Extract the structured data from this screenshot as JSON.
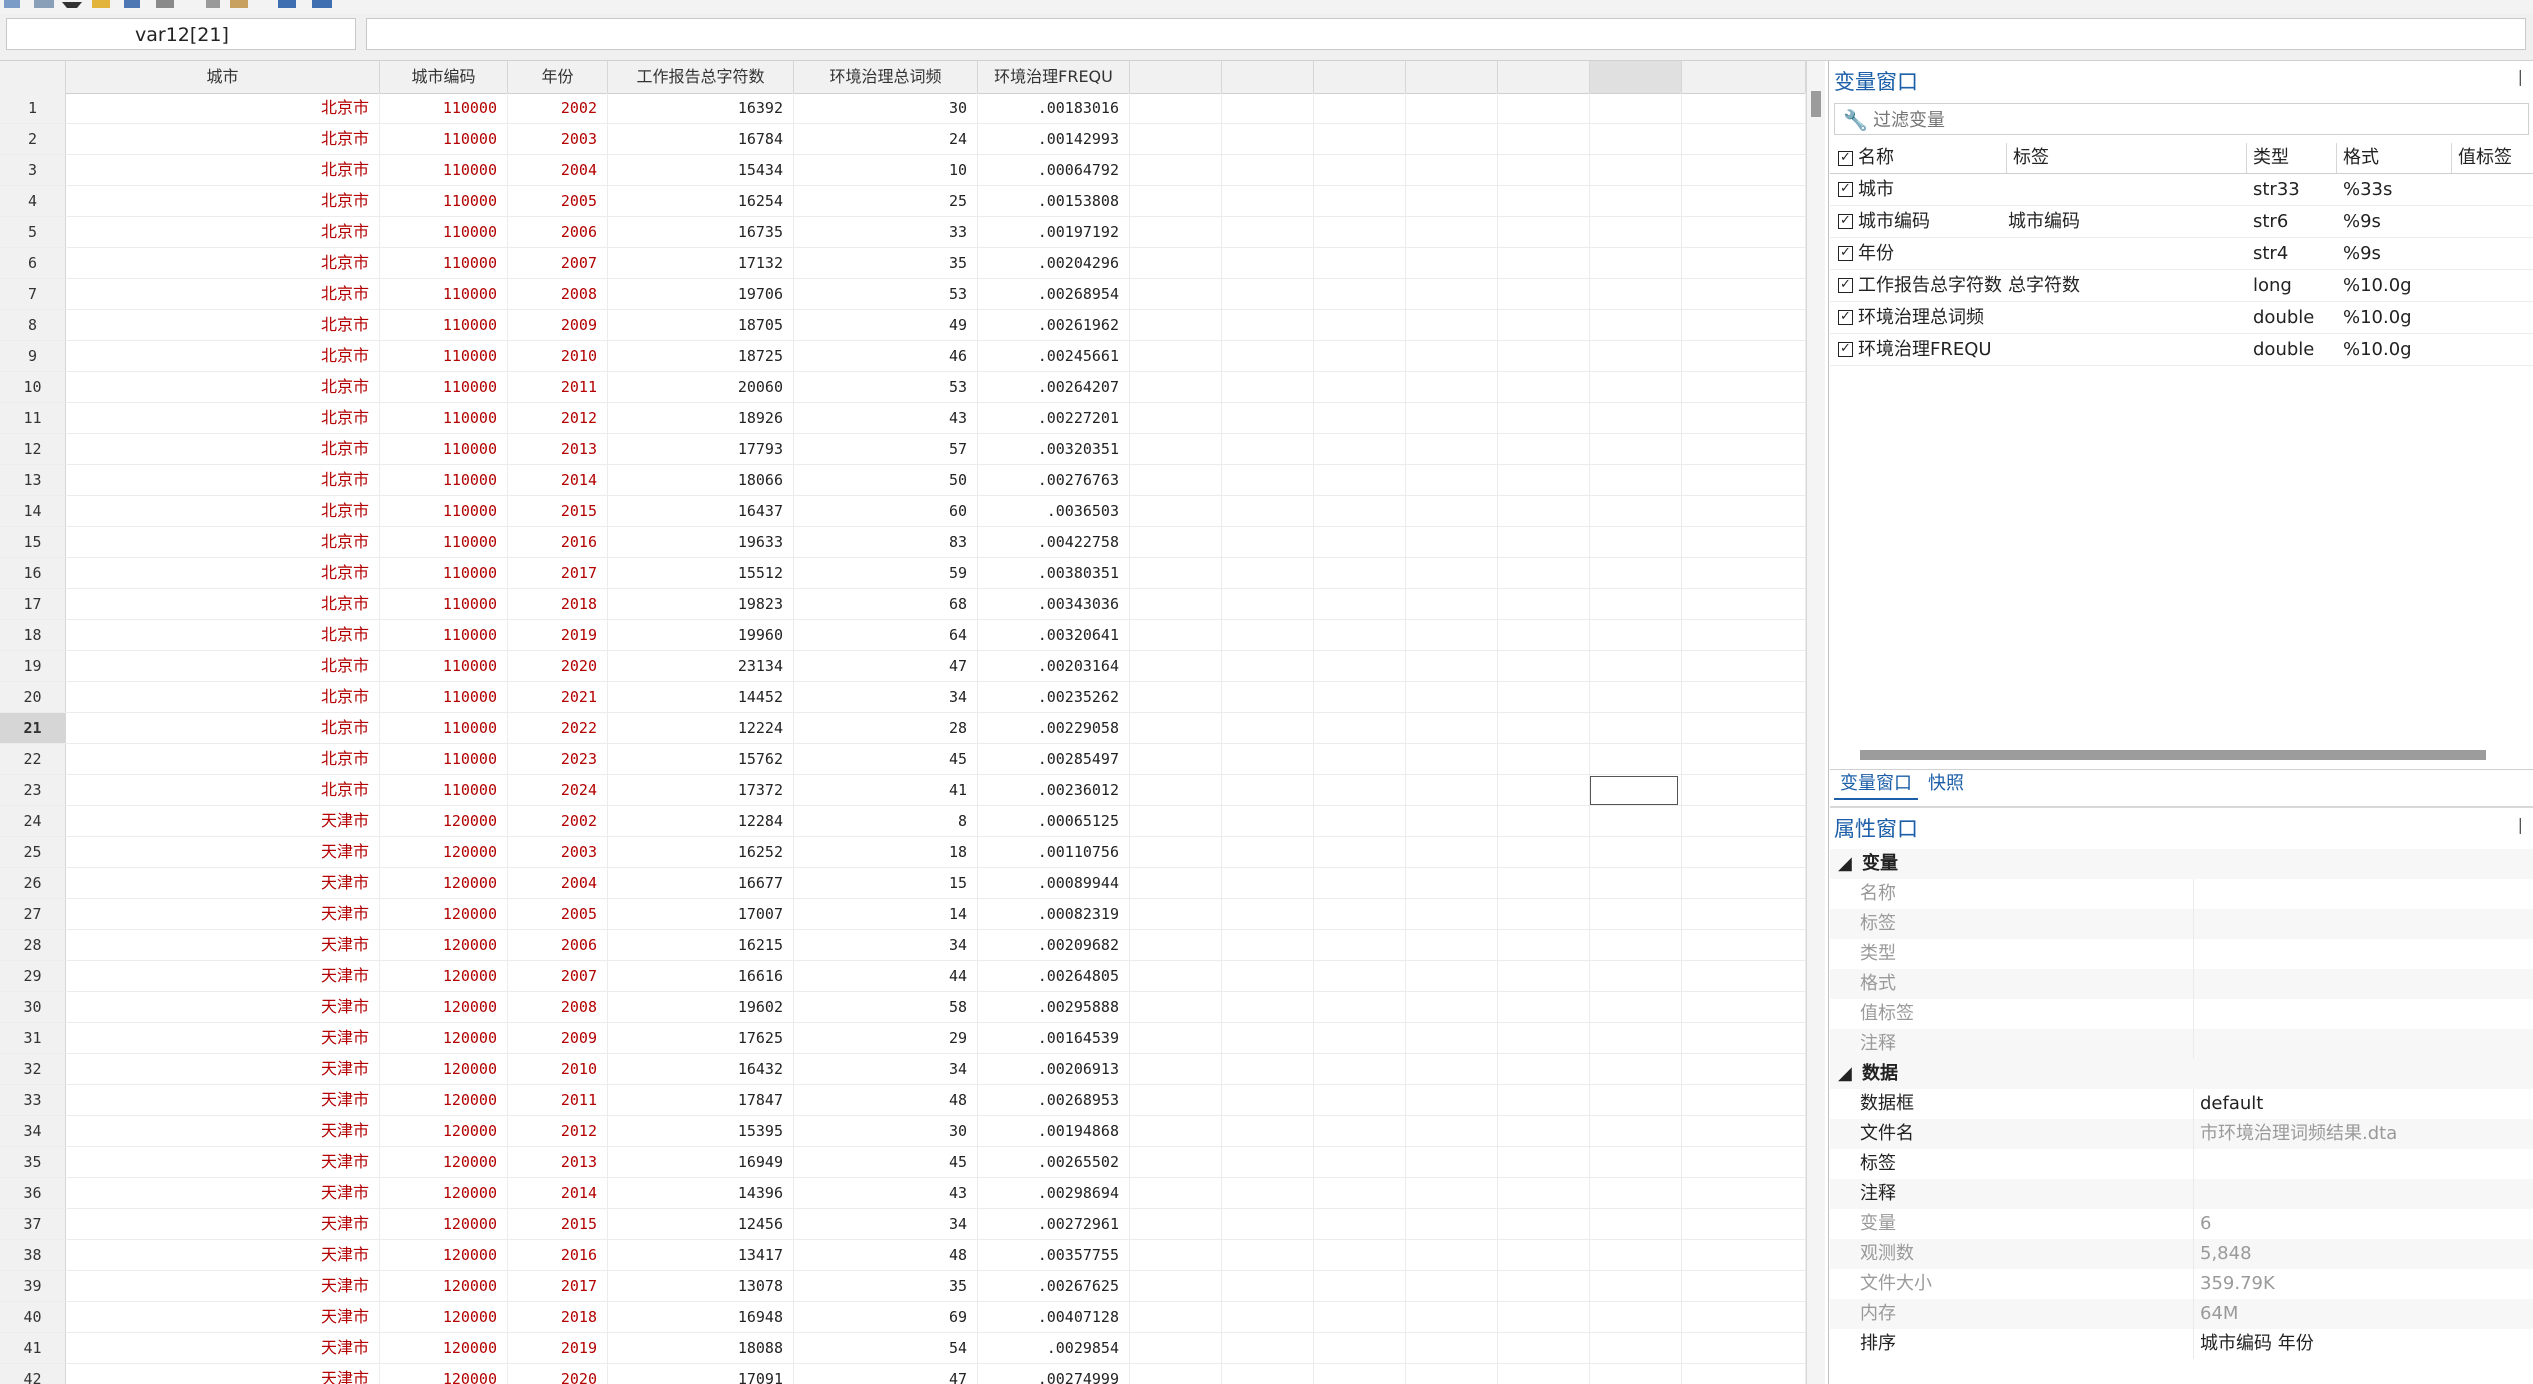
{
  "cellbar": {
    "name": "var12[21]",
    "value": ""
  },
  "grid": {
    "columns": [
      "城市",
      "城市编码",
      "年份",
      "工作报告总字符数",
      "环境治理总词频",
      "环境治理FREQU"
    ],
    "rows": [
      [
        "1",
        "北京市",
        "110000",
        "2002",
        "16392",
        "30",
        ".00183016"
      ],
      [
        "2",
        "北京市",
        "110000",
        "2003",
        "16784",
        "24",
        ".00142993"
      ],
      [
        "3",
        "北京市",
        "110000",
        "2004",
        "15434",
        "10",
        ".00064792"
      ],
      [
        "4",
        "北京市",
        "110000",
        "2005",
        "16254",
        "25",
        ".00153808"
      ],
      [
        "5",
        "北京市",
        "110000",
        "2006",
        "16735",
        "33",
        ".00197192"
      ],
      [
        "6",
        "北京市",
        "110000",
        "2007",
        "17132",
        "35",
        ".00204296"
      ],
      [
        "7",
        "北京市",
        "110000",
        "2008",
        "19706",
        "53",
        ".00268954"
      ],
      [
        "8",
        "北京市",
        "110000",
        "2009",
        "18705",
        "49",
        ".00261962"
      ],
      [
        "9",
        "北京市",
        "110000",
        "2010",
        "18725",
        "46",
        ".00245661"
      ],
      [
        "10",
        "北京市",
        "110000",
        "2011",
        "20060",
        "53",
        ".00264207"
      ],
      [
        "11",
        "北京市",
        "110000",
        "2012",
        "18926",
        "43",
        ".00227201"
      ],
      [
        "12",
        "北京市",
        "110000",
        "2013",
        "17793",
        "57",
        ".00320351"
      ],
      [
        "13",
        "北京市",
        "110000",
        "2014",
        "18066",
        "50",
        ".00276763"
      ],
      [
        "14",
        "北京市",
        "110000",
        "2015",
        "16437",
        "60",
        ".0036503"
      ],
      [
        "15",
        "北京市",
        "110000",
        "2016",
        "19633",
        "83",
        ".00422758"
      ],
      [
        "16",
        "北京市",
        "110000",
        "2017",
        "15512",
        "59",
        ".00380351"
      ],
      [
        "17",
        "北京市",
        "110000",
        "2018",
        "19823",
        "68",
        ".00343036"
      ],
      [
        "18",
        "北京市",
        "110000",
        "2019",
        "19960",
        "64",
        ".00320641"
      ],
      [
        "19",
        "北京市",
        "110000",
        "2020",
        "23134",
        "47",
        ".00203164"
      ],
      [
        "20",
        "北京市",
        "110000",
        "2021",
        "14452",
        "34",
        ".00235262"
      ],
      [
        "21",
        "北京市",
        "110000",
        "2022",
        "12224",
        "28",
        ".00229058"
      ],
      [
        "22",
        "北京市",
        "110000",
        "2023",
        "15762",
        "45",
        ".00285497"
      ],
      [
        "23",
        "北京市",
        "110000",
        "2024",
        "17372",
        "41",
        ".00236012"
      ],
      [
        "24",
        "天津市",
        "120000",
        "2002",
        "12284",
        "8",
        ".00065125"
      ],
      [
        "25",
        "天津市",
        "120000",
        "2003",
        "16252",
        "18",
        ".00110756"
      ],
      [
        "26",
        "天津市",
        "120000",
        "2004",
        "16677",
        "15",
        ".00089944"
      ],
      [
        "27",
        "天津市",
        "120000",
        "2005",
        "17007",
        "14",
        ".00082319"
      ],
      [
        "28",
        "天津市",
        "120000",
        "2006",
        "16215",
        "34",
        ".00209682"
      ],
      [
        "29",
        "天津市",
        "120000",
        "2007",
        "16616",
        "44",
        ".00264805"
      ],
      [
        "30",
        "天津市",
        "120000",
        "2008",
        "19602",
        "58",
        ".00295888"
      ],
      [
        "31",
        "天津市",
        "120000",
        "2009",
        "17625",
        "29",
        ".00164539"
      ],
      [
        "32",
        "天津市",
        "120000",
        "2010",
        "16432",
        "34",
        ".00206913"
      ],
      [
        "33",
        "天津市",
        "120000",
        "2011",
        "17847",
        "48",
        ".00268953"
      ],
      [
        "34",
        "天津市",
        "120000",
        "2012",
        "15395",
        "30",
        ".00194868"
      ],
      [
        "35",
        "天津市",
        "120000",
        "2013",
        "16949",
        "45",
        ".00265502"
      ],
      [
        "36",
        "天津市",
        "120000",
        "2014",
        "14396",
        "43",
        ".00298694"
      ],
      [
        "37",
        "天津市",
        "120000",
        "2015",
        "12456",
        "34",
        ".00272961"
      ],
      [
        "38",
        "天津市",
        "120000",
        "2016",
        "13417",
        "48",
        ".00357755"
      ],
      [
        "39",
        "天津市",
        "120000",
        "2017",
        "13078",
        "35",
        ".00267625"
      ],
      [
        "40",
        "天津市",
        "120000",
        "2018",
        "16948",
        "69",
        ".00407128"
      ],
      [
        "41",
        "天津市",
        "120000",
        "2019",
        "18088",
        "54",
        ".0029854"
      ],
      [
        "42",
        "天津市",
        "120000",
        "2020",
        "17091",
        "47",
        ".00274999"
      ]
    ],
    "current_row": "21"
  },
  "variables": {
    "title": "变量窗口",
    "filter_placeholder": "过滤变量",
    "headers": [
      "名称",
      "标签",
      "类型",
      "格式",
      "值标签"
    ],
    "items": [
      {
        "name": "城市",
        "label": "",
        "type": "str33",
        "format": "%33s"
      },
      {
        "name": "城市编码",
        "label": "城市编码",
        "type": "str6",
        "format": "%9s"
      },
      {
        "name": "年份",
        "label": "",
        "type": "str4",
        "format": "%9s"
      },
      {
        "name": "工作报告总字符数",
        "label": "总字符数",
        "type": "long",
        "format": "%10.0g"
      },
      {
        "name": "环境治理总词频",
        "label": "",
        "type": "double",
        "format": "%10.0g"
      },
      {
        "name": "环境治理FREQU",
        "label": "",
        "type": "double",
        "format": "%10.0g"
      }
    ],
    "tabs": [
      "变量窗口",
      "快照"
    ]
  },
  "properties": {
    "title": "属性窗口",
    "var_section": "变量",
    "var_fields": [
      "名称",
      "标签",
      "类型",
      "格式",
      "值标签",
      "注释"
    ],
    "data_section": "数据",
    "data_fields": [
      {
        "k": "数据框",
        "v": "default"
      },
      {
        "k": "文件名",
        "v": "市环境治理词频结果.dta"
      },
      {
        "k": "标签",
        "v": ""
      },
      {
        "k": "注释",
        "v": ""
      },
      {
        "k": "变量",
        "v": "6"
      },
      {
        "k": "观测数",
        "v": "5,848"
      },
      {
        "k": "文件大小",
        "v": "359.79K"
      },
      {
        "k": "内存",
        "v": "64M"
      },
      {
        "k": "排序",
        "v": "城市编码 年份"
      }
    ]
  },
  "icons": [
    "grid-view-icon",
    "table-icon",
    "dropdown-icon",
    "folder-icon",
    "save-icon",
    "print-icon",
    "copy-icon",
    "paste-icon",
    "search-icon",
    "filter-icon",
    "wrench-icon",
    "pin-icon"
  ]
}
